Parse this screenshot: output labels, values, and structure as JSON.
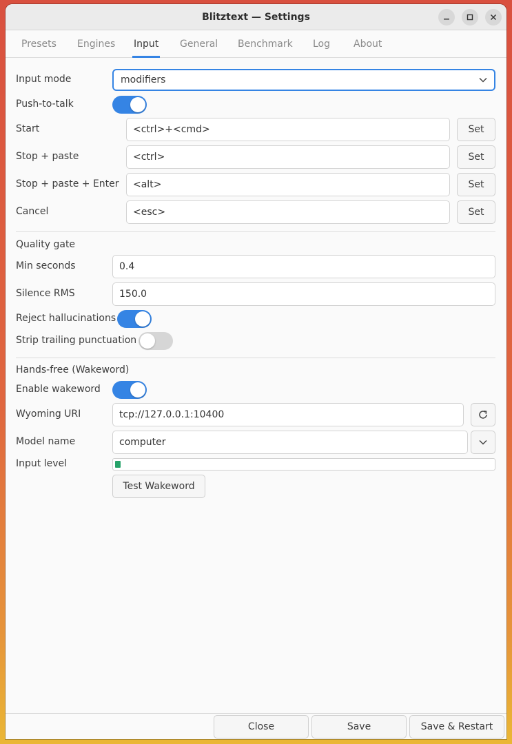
{
  "window": {
    "title": "Blitztext — Settings"
  },
  "tabs": [
    {
      "label": "Presets"
    },
    {
      "label": "Engines"
    },
    {
      "label": "Input"
    },
    {
      "label": "General"
    },
    {
      "label": "Benchmark"
    },
    {
      "label": "Log"
    },
    {
      "label": "About"
    }
  ],
  "input": {
    "mode_label": "Input mode",
    "mode_value": "modifiers",
    "ptt_label": "Push-to-talk",
    "ptt_on": true,
    "hotkeys": [
      {
        "label": "Start",
        "value": "<ctrl>+<cmd>",
        "button": "Set"
      },
      {
        "label": "Stop + paste",
        "value": "<ctrl>",
        "button": "Set"
      },
      {
        "label": "Stop + paste + Enter",
        "value": "<alt>",
        "button": "Set"
      },
      {
        "label": "Cancel",
        "value": "<esc>",
        "button": "Set"
      }
    ]
  },
  "quality": {
    "heading": "Quality gate",
    "min_seconds_label": "Min seconds",
    "min_seconds_value": "0.4",
    "silence_label": "Silence RMS",
    "silence_value": "150.0",
    "reject_label": "Reject hallucinations",
    "reject_on": true,
    "strip_label": "Strip trailing punctuation",
    "strip_on": false
  },
  "wakeword": {
    "heading": "Hands-free (Wakeword)",
    "enable_label": "Enable wakeword",
    "enable_on": true,
    "uri_label": "Wyoming URI",
    "uri_value": "tcp://127.0.0.1:10400",
    "model_label": "Model name",
    "model_value": "computer",
    "level_label": "Input level",
    "level_fraction": 0.015,
    "test_button": "Test Wakeword"
  },
  "footer": {
    "close": "Close",
    "save": "Save",
    "save_restart": "Save & Restart"
  },
  "colors": {
    "accent": "#3584e4",
    "level": "#26a269"
  }
}
